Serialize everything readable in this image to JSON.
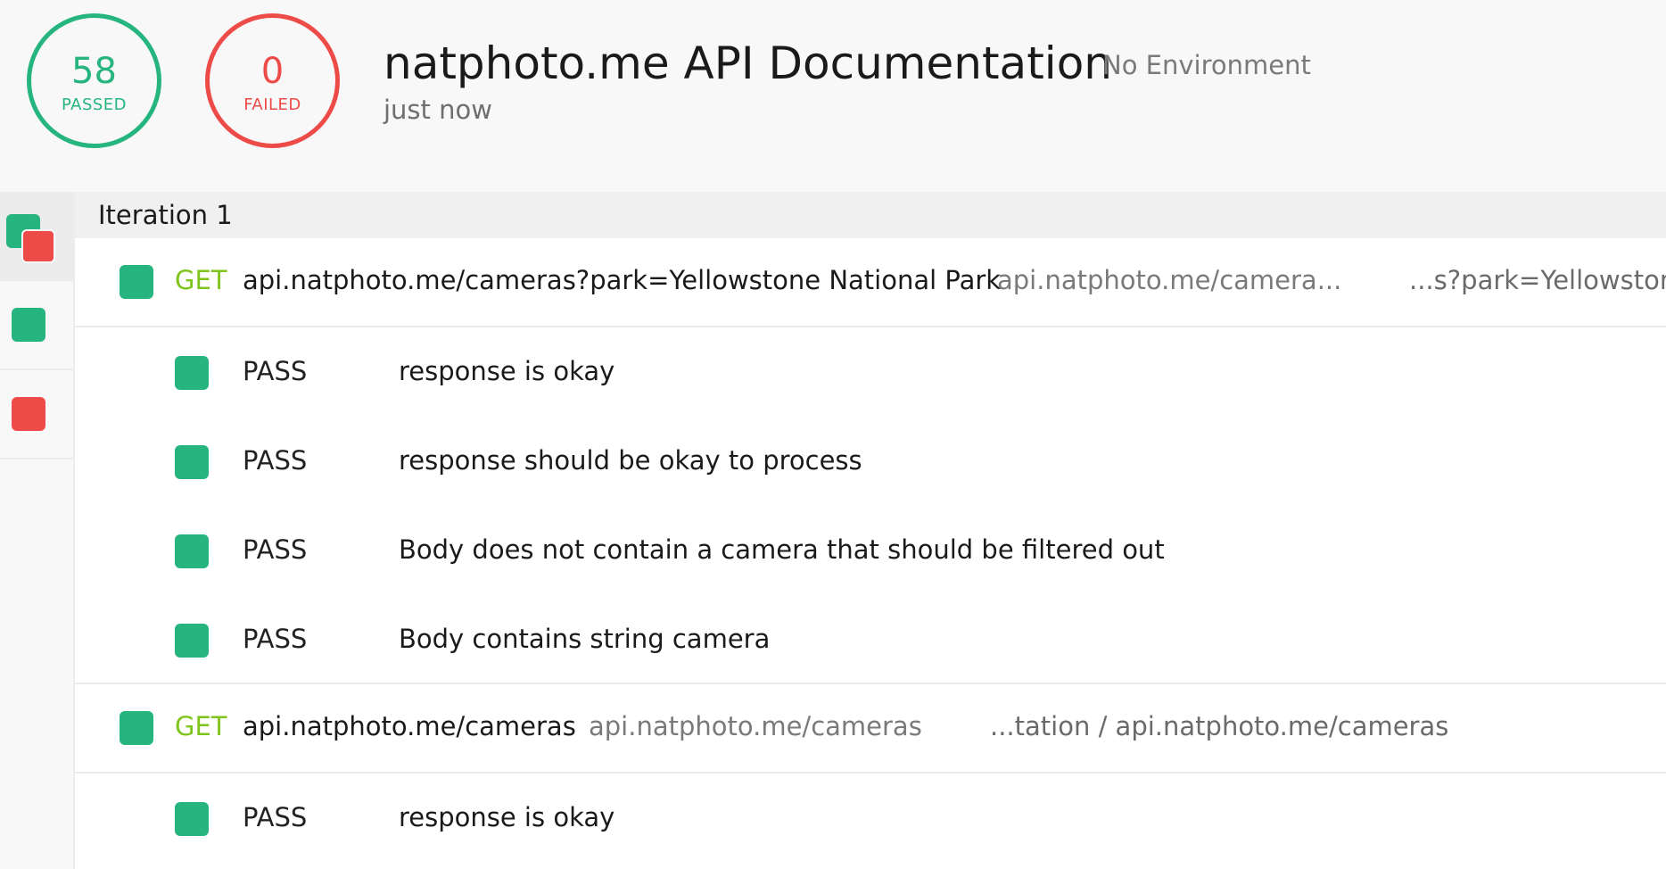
{
  "summary": {
    "passed_count": "58",
    "passed_label": "PASSED",
    "failed_count": "0",
    "failed_label": "FAILED"
  },
  "header": {
    "title": "natphoto.me API Documentation",
    "environment": "No Environment",
    "run_time": "just now"
  },
  "iteration": {
    "label": "Iteration 1"
  },
  "requests": [
    {
      "method": "GET",
      "url": "api.natphoto.me/cameras?park=Yellowstone National Park",
      "name": "api.natphoto.me/camera...",
      "path": "...s?park=Yellowstone",
      "tests": [
        {
          "status": "PASS",
          "name": "response is okay"
        },
        {
          "status": "PASS",
          "name": "response should be okay to process"
        },
        {
          "status": "PASS",
          "name": "Body does not contain a camera that should be filtered out"
        },
        {
          "status": "PASS",
          "name": "Body contains string camera"
        }
      ]
    },
    {
      "method": "GET",
      "url": "api.natphoto.me/cameras",
      "name": "api.natphoto.me/cameras",
      "path": "...tation / api.natphoto.me/cameras",
      "tests": [
        {
          "status": "PASS",
          "name": "response is okay"
        }
      ]
    }
  ],
  "colors": {
    "pass": "#26b47f",
    "fail": "#ed4b48",
    "method_get": "#7ec41a"
  },
  "icons": {
    "filter_all": "mixed-status-icon",
    "filter_passed": "passed-square-icon",
    "filter_failed": "failed-square-icon",
    "status": "status-square-icon"
  }
}
